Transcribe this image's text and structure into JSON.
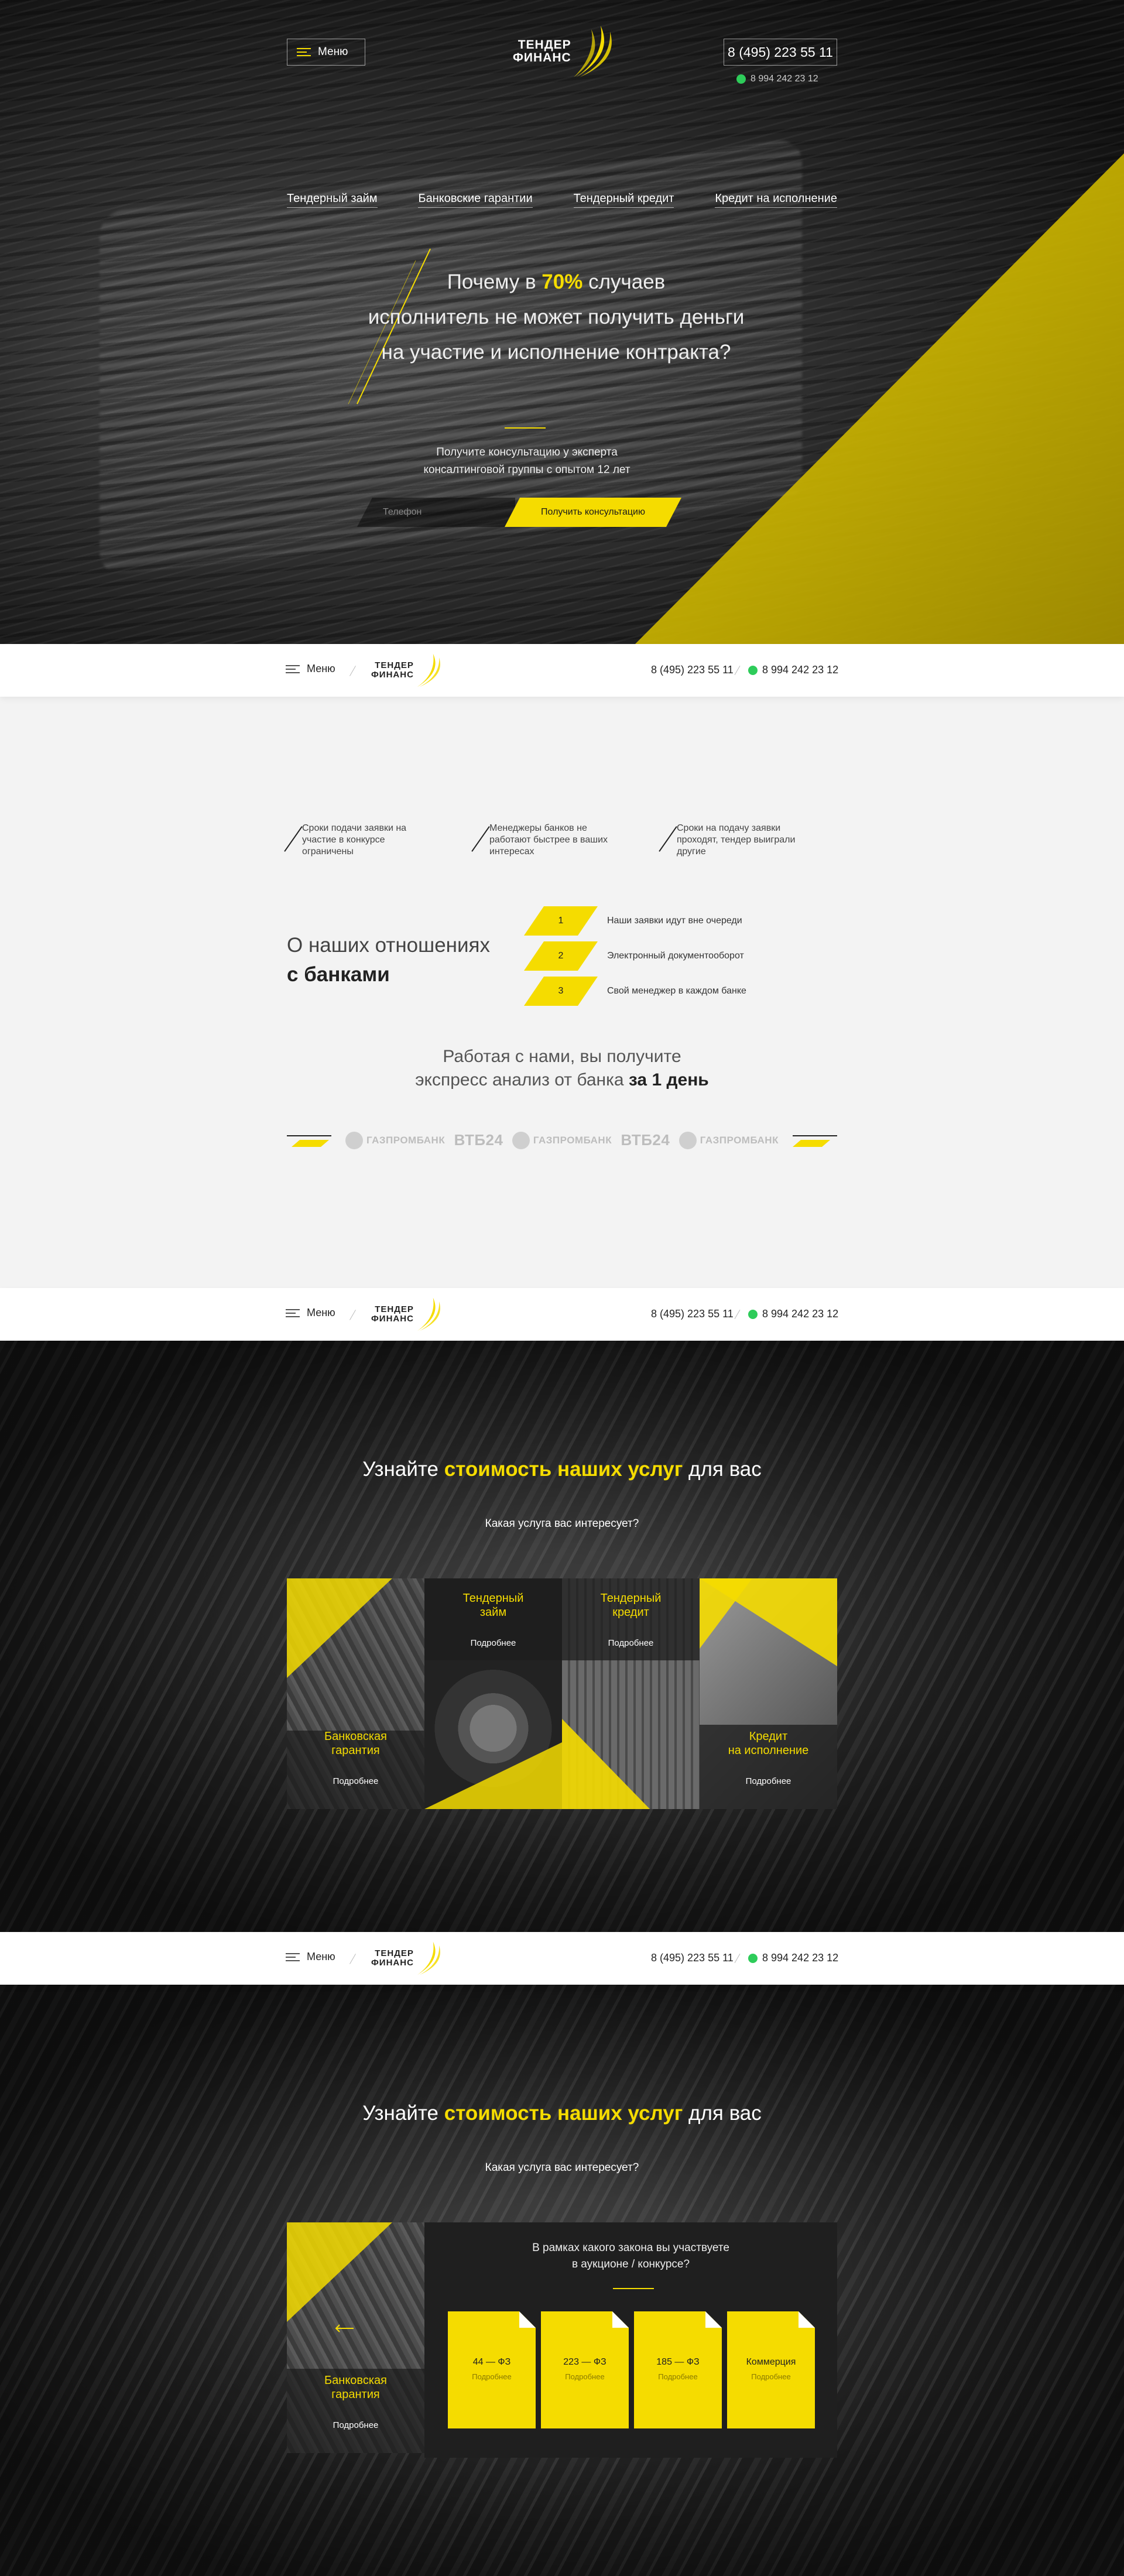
{
  "header": {
    "menu_label": "Меню",
    "logo_line1": "ТЕНДЕР",
    "logo_line2": "ФИНАНС",
    "phone": "8 (495) 223 55 11",
    "whatsapp": "8 994 242 23 12"
  },
  "nav": [
    "Тендерный займ",
    "Банковские гарантии",
    "Тендерный кредит",
    "Кредит на исполнение"
  ],
  "hero": {
    "title_pre": "Почему в ",
    "title_highlight": "70%",
    "title_post": " случаев",
    "title_line2": "исполнитель не может получить деньги",
    "title_line3": "на участие и исполнение контракта?",
    "subtitle_line1": "Получите консультацию у эксперта",
    "subtitle_line2": "консалтинговой группы с опытом 12 лет",
    "phone_placeholder": "Телефон",
    "cta": "Получить консультацию"
  },
  "bar": {
    "menu_label": "Меню",
    "logo_line1": "ТЕНДЕР",
    "logo_line2": "ФИНАНС",
    "phone": "8 (495) 223 55 11",
    "whatsapp": "8 994 242 23 12"
  },
  "features": [
    "Сроки подачи заявки на участие в конкурсе ограничены",
    "Менеджеры банков не работают быстрее в ваших интересах",
    "Сроки на подачу заявки проходят, тендер выиграли другие"
  ],
  "relations": {
    "title_line1": "О наших отношениях",
    "title_line2": "с банками",
    "steps": [
      {
        "num": "1",
        "text": "Наши заявки идут вне очереди"
      },
      {
        "num": "2",
        "text": "Электронный документооборот"
      },
      {
        "num": "3",
        "text": "Свой менеджер в каждом банке"
      }
    ]
  },
  "express": {
    "line1": "Работая с нами, вы получите",
    "line2_pre": "экспресс анализ от банка ",
    "line2_bold": "за 1 день"
  },
  "bank_logos": [
    "ГАЗПРОМБАНК",
    "ВТБ24",
    "ГАЗПРОМБАНК",
    "ВТБ24",
    "ГАЗПРОМБАНК"
  ],
  "services": {
    "title_pre": "Узнайте ",
    "title_highlight": "стоимость наших услуг",
    "title_post": " для вас",
    "question": "Какая услуга вас интересует?",
    "more": "Подробнее",
    "cards": [
      {
        "line1": "Банковская",
        "line2": "гарантия"
      },
      {
        "line1": "Тендерный",
        "line2": "займ"
      },
      {
        "line1": "Тендерный",
        "line2": "кредит"
      },
      {
        "line1": "Кредит",
        "line2": "на исполнение"
      }
    ]
  },
  "laws": {
    "question_line1": "В рамках какого закона вы участвуете",
    "question_line2": "в аукционе / конкурсе?",
    "items": [
      {
        "label": "44 — ФЗ",
        "more": "Подробнее"
      },
      {
        "label": "223 — ФЗ",
        "more": "Подробнее"
      },
      {
        "label": "185 — ФЗ",
        "more": "Подробнее"
      },
      {
        "label": "Коммерция",
        "more": "Подробнее"
      }
    ]
  },
  "colors": {
    "accent": "#f5dc00",
    "dark": "#1f1f1f",
    "light_bg": "#f3f3f3"
  }
}
